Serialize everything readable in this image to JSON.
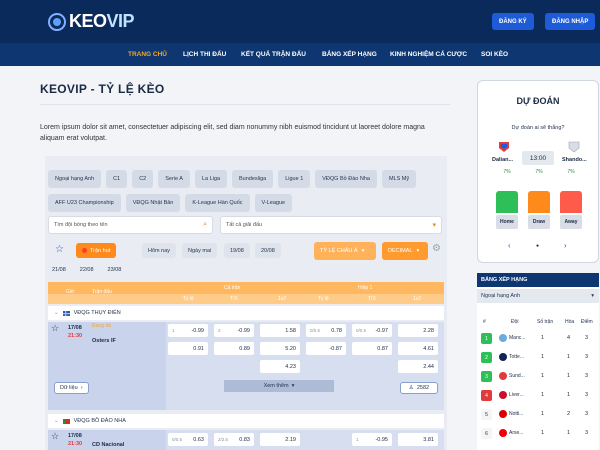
{
  "header": {
    "logo_main": "KEO",
    "logo_vip": "VIP",
    "register_label": "ĐĂNG KÝ",
    "login_label": "ĐĂNG NHẬP"
  },
  "nav": {
    "items": [
      "TRANG CHỦ",
      "LỊCH THI ĐẤU",
      "KẾT QUẢ TRẬN ĐẤU",
      "BẢNG XẾP HẠNG",
      "KINH NGHIỆM CÁ CƯỢC",
      "SOI KÈO"
    ],
    "active": 0
  },
  "main": {
    "title": "KEOVIP - TỶ LỆ KÈO",
    "intro": "Lorem ipsum dolor sit amet, consectetuer adipiscing elit, sed diam nonummy nibh euismod tincidunt ut laoreet dolore magna aliquam erat volutpat."
  },
  "filters": {
    "chips": [
      "Ngoại hạng Anh",
      "C1",
      "C2",
      "Serie A",
      "La Liga",
      "Bundesliga",
      "Ligue 1",
      "VĐQG Bồ Đào Nha",
      "MLS Mỹ",
      "AFF U23 Championship",
      "VĐQG Nhật Bản",
      "K-League Hàn Quốc",
      "V-League"
    ],
    "search_placeholder": "Tìm đội bóng theo tên",
    "league_select": "Tất cả giải đấu",
    "hot_label": "Trận hot",
    "day_pills": [
      "Hôm nay",
      "Ngày mai",
      "19/08",
      "20/08"
    ],
    "dates": [
      "21/08",
      "22/08",
      "23/08"
    ],
    "type_select": "TỶ LỆ CHÂU Á",
    "rate_select": "DECIMAL"
  },
  "table": {
    "col_time": "Giờ",
    "col_match": "Trận đấu",
    "group_full": "Cả trận",
    "group_half": "Hiệp 1",
    "sub_headers": [
      "Tỷ lệ",
      "T/X",
      "1x2",
      "Tỷ lệ",
      "T/X",
      "1x2"
    ],
    "leagues": [
      {
        "name": "VĐQG THỤY ĐIỂN",
        "match": {
          "date": "17/08",
          "time": "21:30",
          "live": "Đang đá",
          "team": "Osters IF",
          "rows": [
            [
              "1",
              "-0.99",
              "2",
              "-0.99",
              "1.58",
              "0/0.5",
              "0.78",
              "0/0.5",
              "-0.97",
              "2.28"
            ],
            [
              "",
              "0.91",
              "",
              "0.89",
              "5.20",
              "",
              "-0.87",
              "",
              "0.87",
              "4.61"
            ],
            [
              "",
              "",
              "",
              "",
              "4.23",
              "",
              "",
              "",
              "",
              "2.44"
            ]
          ],
          "data_label": "Dữ liệu",
          "more_label": "Xem thêm",
          "views": "2582"
        }
      },
      {
        "name": "VĐQG BỒ ĐÀO NHA",
        "match": {
          "date": "17/08",
          "time": "21:30",
          "team": "CD Nacional",
          "rows": [
            [
              "0/0.5",
              "0.63",
              "2/2.5",
              "0.83",
              "2.19",
              "",
              "",
              "1",
              "-0.95",
              "3.81"
            ]
          ]
        }
      }
    ]
  },
  "prediction": {
    "title": "DỰ ĐOÁN",
    "question": "Dự đoán ai sẽ thắng?",
    "home_team": "Dalian...",
    "away_team": "Shando...",
    "time": "13:00",
    "options": [
      {
        "label": "Home",
        "pct": "7%",
        "value": 0.55,
        "color": "#2fbf58"
      },
      {
        "label": "Draw",
        "pct": "7%",
        "value": 0.55,
        "color": "#ff8a1c"
      },
      {
        "label": "Away",
        "pct": "7%",
        "value": 0.55,
        "color": "#ff5b4a"
      }
    ],
    "prev_label": "‹",
    "next_label": "›",
    "dot_label": "●"
  },
  "ranking": {
    "title": "BẢNG XẾP HẠNG",
    "league": "Ngoại hạng Anh",
    "headers": [
      "#",
      "Đội",
      "Số trận",
      "Hòa",
      "Điểm"
    ],
    "rows": [
      {
        "pos": "1",
        "team": "Manc...",
        "played": "1",
        "draw": "4",
        "points": "3",
        "color": "#2fbf58"
      },
      {
        "pos": "2",
        "team": "Totte...",
        "played": "1",
        "draw": "1",
        "points": "3",
        "color": "#2fbf58"
      },
      {
        "pos": "3",
        "team": "Sund...",
        "played": "1",
        "draw": "1",
        "points": "3",
        "color": "#2fbf58"
      },
      {
        "pos": "4",
        "team": "Liver...",
        "played": "1",
        "draw": "1",
        "points": "3",
        "color": "#e23b3b"
      },
      {
        "pos": "5",
        "team": "Notti...",
        "played": "1",
        "draw": "2",
        "points": "3",
        "color": "#f5f5f5"
      },
      {
        "pos": "6",
        "team": "Arse...",
        "played": "1",
        "draw": "1",
        "points": "3",
        "color": "#f5f5f5"
      }
    ]
  }
}
